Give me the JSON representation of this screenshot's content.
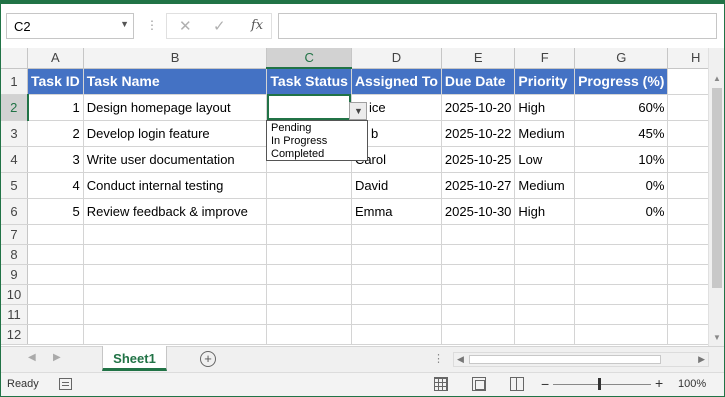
{
  "formula_bar": {
    "name_box": "C2",
    "cancel_icon": "✕",
    "enter_icon": "✓",
    "function_icon": "fx",
    "formula_value": ""
  },
  "columns": [
    "A",
    "B",
    "C",
    "D",
    "E",
    "F",
    "G",
    "H"
  ],
  "active_column": "C",
  "rows": [
    {
      "num": "1",
      "cells": [
        "Task ID",
        "Task Name",
        "Task Status",
        "Assigned To",
        "Due Date",
        "Priority",
        "Progress (%)",
        ""
      ]
    },
    {
      "num": "2",
      "cells": [
        "1",
        "Design homepage layout",
        "",
        "ice",
        "2025-10-20",
        "High",
        "60%",
        ""
      ]
    },
    {
      "num": "3",
      "cells": [
        "2",
        "Develop login feature",
        "",
        "b",
        "2025-10-22",
        "Medium",
        "45%",
        ""
      ]
    },
    {
      "num": "4",
      "cells": [
        "3",
        "Write user documentation",
        "",
        "Carol",
        "2025-10-25",
        "Low",
        "10%",
        ""
      ]
    },
    {
      "num": "5",
      "cells": [
        "4",
        "Conduct internal testing",
        "",
        "David",
        "2025-10-27",
        "Medium",
        "0%",
        ""
      ]
    },
    {
      "num": "6",
      "cells": [
        "5",
        "Review feedback & improve",
        "",
        "Emma",
        "2025-10-30",
        "High",
        "0%",
        ""
      ]
    },
    {
      "num": "7",
      "cells": [
        "",
        "",
        "",
        "",
        "",
        "",
        "",
        ""
      ]
    },
    {
      "num": "8",
      "cells": [
        "",
        "",
        "",
        "",
        "",
        "",
        "",
        ""
      ]
    },
    {
      "num": "9",
      "cells": [
        "",
        "",
        "",
        "",
        "",
        "",
        "",
        ""
      ]
    },
    {
      "num": "10",
      "cells": [
        "",
        "",
        "",
        "",
        "",
        "",
        "",
        ""
      ]
    },
    {
      "num": "11",
      "cells": [
        "",
        "",
        "",
        "",
        "",
        "",
        "",
        ""
      ]
    },
    {
      "num": "12",
      "cells": [
        "",
        "",
        "",
        "",
        "",
        "",
        "",
        ""
      ]
    }
  ],
  "dropdown": {
    "options": [
      "Pending",
      "In Progress",
      "Completed"
    ]
  },
  "sheet_tabs": [
    "Sheet1"
  ],
  "status_bar": {
    "status": "Ready",
    "zoom": "100%"
  },
  "colors": {
    "header_fill": "#4472c4",
    "accent": "#217346"
  }
}
